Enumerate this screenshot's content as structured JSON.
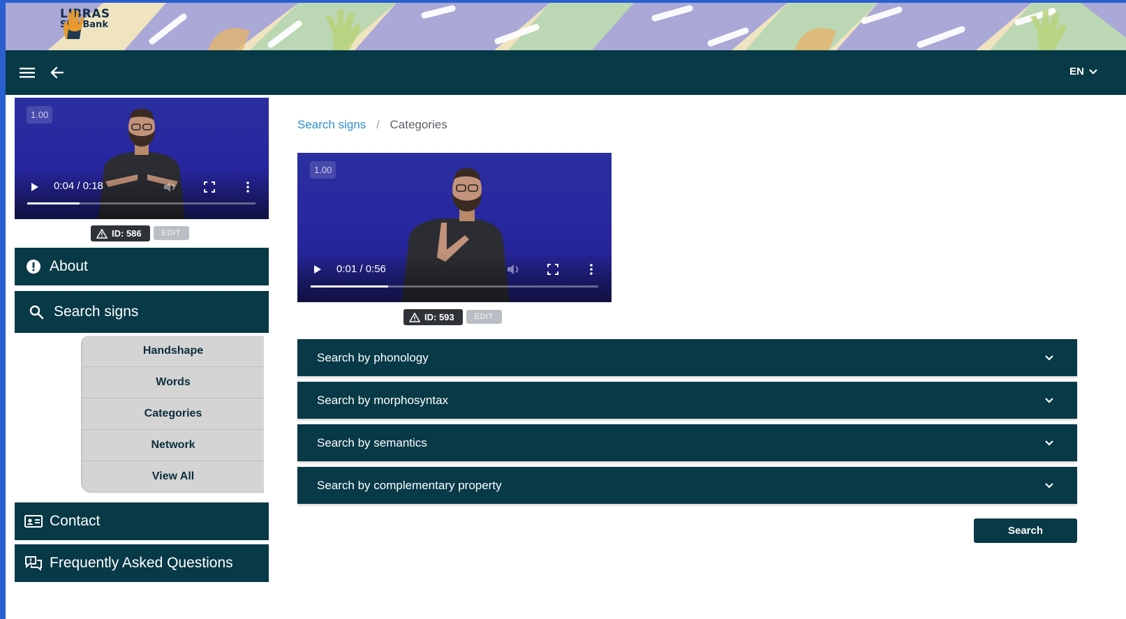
{
  "brand": {
    "line1": "LIBRAS",
    "line2": "SignBank"
  },
  "topnav": {
    "language": "EN"
  },
  "sidebar_video": {
    "rate": "1.00",
    "time": "0:04 / 0:18",
    "progress": 0.23,
    "id_label": "ID: 586",
    "edit_label": "EDIT"
  },
  "sidebar": {
    "about": "About",
    "search_signs": "Search signs",
    "sub_items": [
      "Handshape",
      "Words",
      "Categories",
      "Network",
      "View All"
    ],
    "contact": "Contact",
    "faq": "Frequently Asked Questions"
  },
  "breadcrumb": {
    "parent": "Search signs",
    "separator": "/",
    "current": "Categories"
  },
  "main_video": {
    "rate": "1.00",
    "time": "0:01 / 0:56",
    "progress": 0.27,
    "id_label": "ID: 593",
    "edit_label": "EDIT"
  },
  "accordions": [
    "Search by phonology",
    "Search by morphosyntax",
    "Search by semantics",
    "Search by complementary property"
  ],
  "search_button": "Search",
  "colors": {
    "primary": "#073947",
    "link": "#2f8fd0",
    "submenu_bg": "#d4d4d4",
    "badge": "#2f3337"
  }
}
